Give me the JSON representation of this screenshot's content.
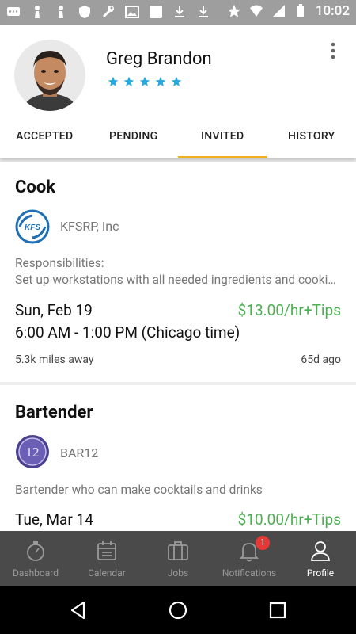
{
  "status_bar": {
    "time": "10:02"
  },
  "profile": {
    "name": "Greg Brandon",
    "rating": 5,
    "star_color": "#29a8e0"
  },
  "tabs": [
    {
      "label": "ACCEPTED"
    },
    {
      "label": "PENDING"
    },
    {
      "label": "INVITED",
      "active": true
    },
    {
      "label": "HISTORY"
    }
  ],
  "jobs": [
    {
      "title": "Cook",
      "company": "KFSRP, Inc",
      "description_label": "Responsibilities:",
      "description": "Set up workstations with all needed ingredients and cooking equipment",
      "date": "Sun, Feb 19",
      "pay": "$13.00/hr+Tips",
      "time": "6:00 AM - 1:00 PM (Chicago time)",
      "distance": "5.3k miles away",
      "posted": "65d ago"
    },
    {
      "title": "Bartender",
      "company": "BAR12",
      "description": "Bartender who can make cocktails and drinks",
      "date": "Tue, Mar 14",
      "pay": "$10.00/hr+Tips"
    }
  ],
  "bottom_nav": [
    {
      "label": "Dashboard",
      "icon": "stopwatch-icon"
    },
    {
      "label": "Calendar",
      "icon": "calendar-icon"
    },
    {
      "label": "Jobs",
      "icon": "briefcase-icon"
    },
    {
      "label": "Notifications",
      "icon": "bell-icon",
      "badge": "1"
    },
    {
      "label": "Profile",
      "icon": "person-icon",
      "active": true
    }
  ],
  "colors": {
    "accent_tab": "#f2b01e",
    "pay": "#4caf50",
    "badge": "#e53935"
  }
}
